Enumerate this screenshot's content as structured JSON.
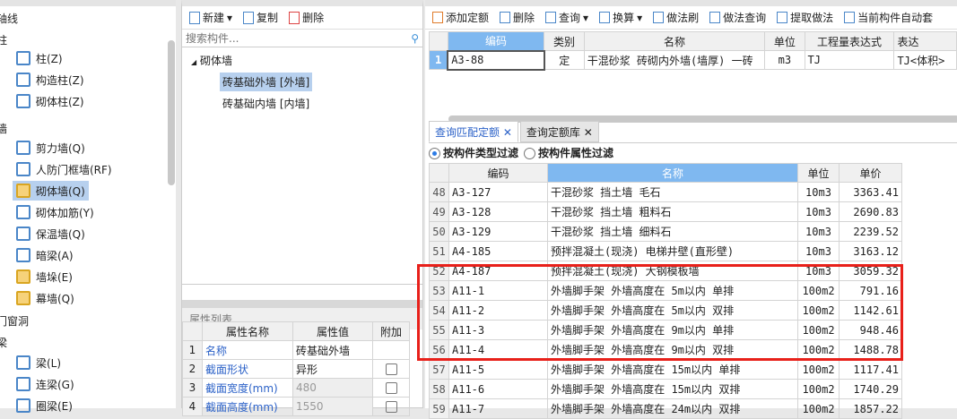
{
  "left": {
    "categories": [
      {
        "label": "轴线"
      },
      {
        "label": "柱"
      },
      {
        "label": "墙"
      },
      {
        "label": "门窗洞"
      },
      {
        "label": "梁"
      }
    ],
    "items": [
      {
        "label": "柱(Z)"
      },
      {
        "label": "构造柱(Z)"
      },
      {
        "label": "砌体柱(Z)"
      },
      {
        "label": "剪力墙(Q)"
      },
      {
        "label": "人防门框墙(RF)"
      },
      {
        "label": "砌体墙(Q)"
      },
      {
        "label": "砌体加筋(Y)"
      },
      {
        "label": "保温墙(Q)"
      },
      {
        "label": "暗梁(A)"
      },
      {
        "label": "墙垛(E)"
      },
      {
        "label": "幕墙(Q)"
      },
      {
        "label": "梁(L)"
      },
      {
        "label": "连梁(G)"
      },
      {
        "label": "圈梁(E)"
      }
    ]
  },
  "mid": {
    "toolbar": {
      "new": "新建",
      "copy": "复制",
      "delete": "删除"
    },
    "search_placeholder": "搜索构件...",
    "tree": {
      "root": "砌体墙",
      "children": [
        "砖基础外墙 [外墙]",
        "砖基础内墙 [内墙]"
      ]
    },
    "props": {
      "title": "属性列表",
      "headers": [
        "属性名称",
        "属性值",
        "附加"
      ],
      "rows": [
        {
          "n": "1",
          "name": "名称",
          "value": "砖基础外墙"
        },
        {
          "n": "2",
          "name": "截面形状",
          "value": "异形"
        },
        {
          "n": "3",
          "name": "截面宽度(mm)",
          "value": "480"
        },
        {
          "n": "4",
          "name": "截面高度(mm)",
          "value": "1550"
        }
      ]
    }
  },
  "right": {
    "toolbar": [
      "添加定额",
      "删除",
      "查询",
      "换算",
      "做法刷",
      "做法查询",
      "提取做法",
      "当前构件自动套"
    ],
    "upper": {
      "headers": [
        "编码",
        "类别",
        "名称",
        "单位",
        "工程量表达式",
        "表达"
      ],
      "rows": [
        {
          "n": "1",
          "code": "A3-88",
          "type": "定",
          "name": "干混砂浆 砖砌内外墙(墙厚) 一砖",
          "unit": "m3",
          "expr": "TJ",
          "expr2": "TJ<体积>"
        }
      ]
    },
    "tabs": [
      "查询匹配定额",
      "查询定额库"
    ],
    "filters": [
      "按构件类型过滤",
      "按构件属性过滤"
    ],
    "lower": {
      "headers": [
        "编码",
        "名称",
        "单位",
        "单价"
      ],
      "rows": [
        {
          "n": "48",
          "code": "A3-127",
          "name": "干混砂浆 挡土墙 毛石",
          "unit": "10m3",
          "price": "3363.41"
        },
        {
          "n": "49",
          "code": "A3-128",
          "name": "干混砂浆 挡土墙 粗料石",
          "unit": "10m3",
          "price": "2690.83"
        },
        {
          "n": "50",
          "code": "A3-129",
          "name": "干混砂浆 挡土墙 细料石",
          "unit": "10m3",
          "price": "2239.52"
        },
        {
          "n": "51",
          "code": "A4-185",
          "name": "预拌混凝土(现浇) 电梯井壁(直形壁)",
          "unit": "10m3",
          "price": "3163.12"
        },
        {
          "n": "52",
          "code": "A4-187",
          "name": "预拌混凝土(现浇) 大钢模板墙",
          "unit": "10m3",
          "price": "3059.32"
        },
        {
          "n": "53",
          "code": "A11-1",
          "name": "外墙脚手架 外墙高度在 5m以内 单排",
          "unit": "100m2",
          "price": "791.16"
        },
        {
          "n": "54",
          "code": "A11-2",
          "name": "外墙脚手架 外墙高度在 5m以内 双排",
          "unit": "100m2",
          "price": "1142.61"
        },
        {
          "n": "55",
          "code": "A11-3",
          "name": "外墙脚手架 外墙高度在 9m以内 单排",
          "unit": "100m2",
          "price": "948.46"
        },
        {
          "n": "56",
          "code": "A11-4",
          "name": "外墙脚手架 外墙高度在 9m以内 双排",
          "unit": "100m2",
          "price": "1488.78"
        },
        {
          "n": "57",
          "code": "A11-5",
          "name": "外墙脚手架 外墙高度在 15m以内 单排",
          "unit": "100m2",
          "price": "1117.41"
        },
        {
          "n": "58",
          "code": "A11-6",
          "name": "外墙脚手架 外墙高度在 15m以内 双排",
          "unit": "100m2",
          "price": "1740.29"
        },
        {
          "n": "59",
          "code": "A11-7",
          "name": "外墙脚手架 外墙高度在 24m以内 双排",
          "unit": "100m2",
          "price": "1857.22"
        }
      ]
    }
  },
  "colors": {
    "highlight": "#e8201a",
    "header_accent": "#7fb8f0",
    "selection": "#b7d0ee"
  }
}
